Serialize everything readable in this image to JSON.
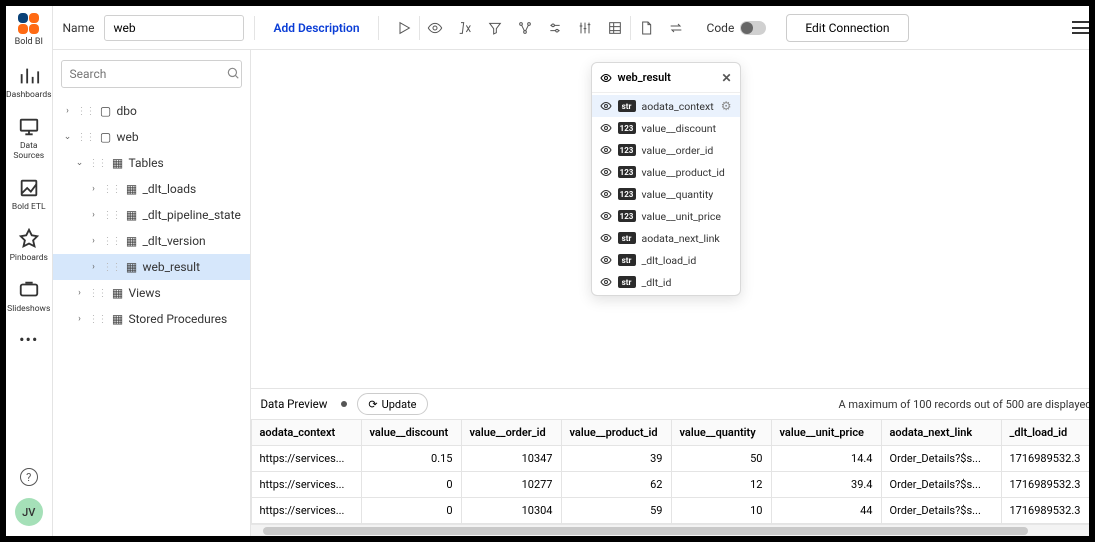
{
  "brand": "Bold BI",
  "rail": {
    "items": [
      {
        "label": "Dashboards"
      },
      {
        "label": "Data Sources"
      },
      {
        "label": "Bold ETL"
      },
      {
        "label": "Pinboards"
      },
      {
        "label": "Slideshows"
      }
    ],
    "avatar": "JV"
  },
  "topbar": {
    "name_label": "Name",
    "name_value": "web",
    "add_description": "Add Description",
    "code_label": "Code",
    "edit_connection": "Edit Connection"
  },
  "sidebar": {
    "search_placeholder": "Search",
    "nodes": {
      "dbo": "dbo",
      "web": "web",
      "tables": "Tables",
      "t_dlt_loads": "_dlt_loads",
      "t_dlt_pipeline_state": "_dlt_pipeline_state",
      "t_dlt_version": "_dlt_version",
      "t_web_result": "web_result",
      "views": "Views",
      "sprocs": "Stored Procedures"
    }
  },
  "colpop": {
    "title": "web_result",
    "cols": [
      {
        "name": "aodata_context",
        "type": "str",
        "selected": true
      },
      {
        "name": "value__discount",
        "type": "123"
      },
      {
        "name": "value__order_id",
        "type": "123"
      },
      {
        "name": "value__product_id",
        "type": "123"
      },
      {
        "name": "value__quantity",
        "type": "123"
      },
      {
        "name": "value__unit_price",
        "type": "123"
      },
      {
        "name": "aodata_next_link",
        "type": "str"
      },
      {
        "name": "_dlt_load_id",
        "type": "str"
      },
      {
        "name": "_dlt_id",
        "type": "str"
      }
    ]
  },
  "preview": {
    "label": "Data Preview",
    "update": "Update",
    "info": "A maximum of 100 records out of 500 are displayed",
    "columns": [
      "aodata_context",
      "value__discount",
      "value__order_id",
      "value__product_id",
      "value__quantity",
      "value__unit_price",
      "aodata_next_link",
      "_dlt_load_id"
    ],
    "rows": [
      {
        "aodata_context": "https://services...",
        "value__discount": "0.15",
        "value__order_id": "10347",
        "value__product_id": "39",
        "value__quantity": "50",
        "value__unit_price": "14.4",
        "aodata_next_link": "Order_Details?$s...",
        "_dlt_load_id": "1716989532.3"
      },
      {
        "aodata_context": "https://services...",
        "value__discount": "0",
        "value__order_id": "10277",
        "value__product_id": "62",
        "value__quantity": "12",
        "value__unit_price": "39.4",
        "aodata_next_link": "Order_Details?$s...",
        "_dlt_load_id": "1716989532.3"
      },
      {
        "aodata_context": "https://services...",
        "value__discount": "0",
        "value__order_id": "10304",
        "value__product_id": "59",
        "value__quantity": "10",
        "value__unit_price": "44",
        "aodata_next_link": "Order_Details?$s...",
        "_dlt_load_id": "1716989532.3"
      }
    ]
  }
}
